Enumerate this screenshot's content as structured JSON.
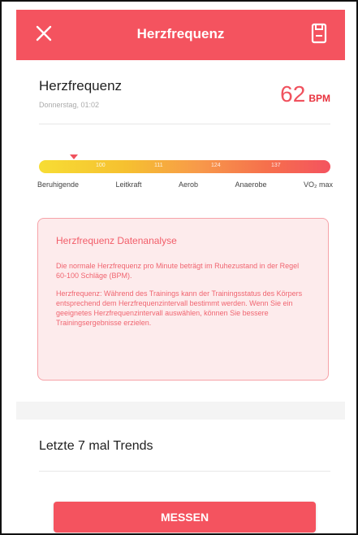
{
  "header": {
    "title": "Herzfrequenz",
    "close_icon": "close-icon",
    "save_icon": "save-icon",
    "color": "#f4535f"
  },
  "heart_rate": {
    "label": "Herzfrequenz",
    "date": "Donnerstag, 01:02",
    "value": "62",
    "unit": "BPM"
  },
  "zones": {
    "ticks": [
      "100",
      "111",
      "124",
      "137"
    ],
    "labels": [
      "Beruhigende",
      "Leitkraft",
      "Aerob",
      "Anaerobe",
      "VO₂ max"
    ]
  },
  "analysis": {
    "title": "Herzfrequenz Datenanalyse",
    "p1": "Die normale Herzfrequenz pro Minute beträgt im Ruhezustand in der Regel 60-100 Schläge (BPM).",
    "p2": "Herzfrequenz: Während des Trainings kann der Trainingsstatus des Körpers entsprechend dem Herzfrequenzintervall bestimmt werden. Wenn Sie ein geeignetes Herzfrequenzintervall auswählen, können Sie bessere Trainingsergebnisse erzielen."
  },
  "trends": {
    "title": "Letzte 7 mal Trends"
  },
  "measure_button": {
    "label": "MESSEN"
  }
}
